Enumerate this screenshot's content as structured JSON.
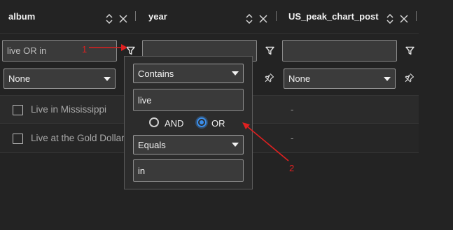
{
  "columns": [
    {
      "header": "album",
      "filter_value": "live OR in",
      "operator": "None"
    },
    {
      "header": "year",
      "filter_value": "",
      "operator": "None"
    },
    {
      "header": "US_peak_chart_post",
      "filter_value": "",
      "operator": "None"
    }
  ],
  "rows": [
    {
      "album": "Live in Mississippi",
      "us_peak": "-"
    },
    {
      "album": "Live at the Gold Dollar",
      "us_peak": "-"
    }
  ],
  "filter_popup": {
    "condition1": {
      "type": "Contains",
      "value": "live"
    },
    "join_and": "AND",
    "join_or": "OR",
    "join_selected": "OR",
    "condition2": {
      "type": "Equals",
      "value": "in"
    }
  },
  "annotations": {
    "one": "1",
    "two": "2",
    "color": "#e02020"
  },
  "colors": {
    "background": "#232323",
    "accent": "#3b8eea"
  }
}
